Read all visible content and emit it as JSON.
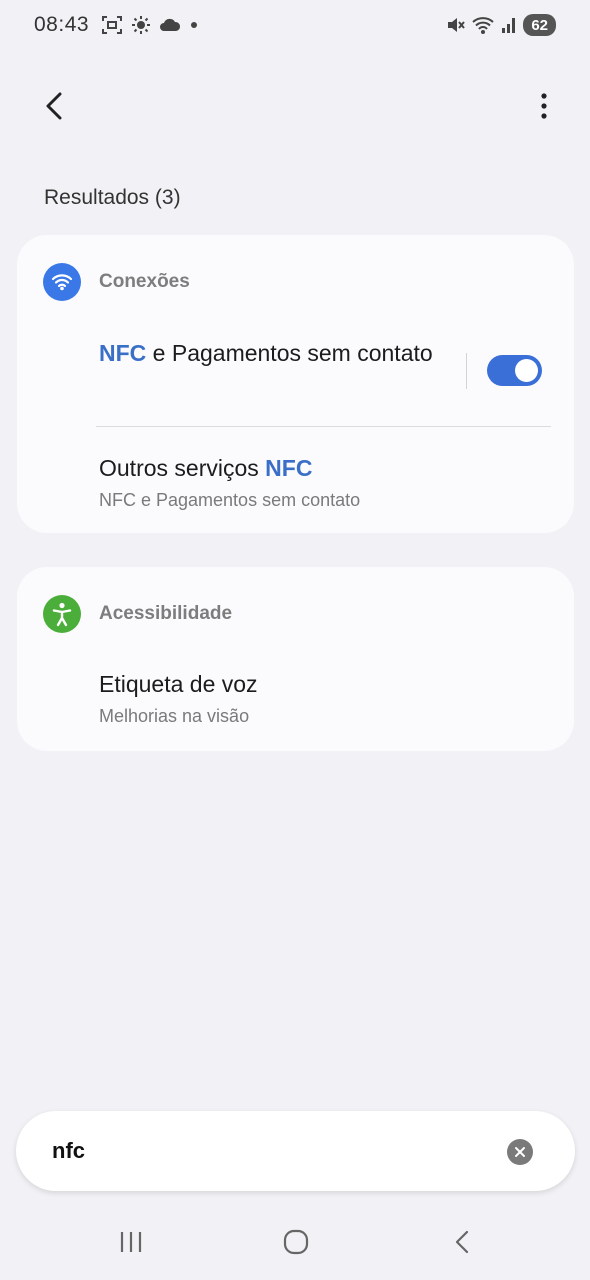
{
  "status_bar": {
    "time": "08:43",
    "battery": "62",
    "left_icons": [
      "screenshot-icon",
      "brightness-icon",
      "cloud-icon",
      "dot-icon"
    ],
    "right_icons": [
      "mute-icon",
      "wifi-icon",
      "signal-icon"
    ]
  },
  "app_bar": {
    "back_icon": "back-arrow-icon",
    "more_icon": "more-vert-icon"
  },
  "results": {
    "header": "Resultados (3)"
  },
  "groups": [
    {
      "category": "Conexões",
      "icon": "wifi-icon",
      "icon_color": "#3b78e7",
      "items": [
        {
          "title_highlight": "NFC",
          "title_rest": " e Pagamentos sem contato",
          "toggle_on": true
        },
        {
          "title_prefix": "Outros serviços ",
          "title_highlight": "NFC",
          "subtitle": "NFC e Pagamentos sem contato"
        }
      ]
    },
    {
      "category": "Acessibilidade",
      "icon": "accessibility-icon",
      "icon_color": "#4cae3a",
      "items": [
        {
          "title": "Etiqueta de voz",
          "subtitle": "Melhorias na visão"
        }
      ]
    }
  ],
  "search": {
    "value": "nfc",
    "clear_icon": "clear-icon"
  },
  "nav_bar": {
    "icons": [
      "recents-icon",
      "home-icon",
      "back-icon"
    ]
  },
  "colors": {
    "accent": "#3a6fc8",
    "toggle": "#3a6fd8",
    "background": "#f2f2f6"
  }
}
